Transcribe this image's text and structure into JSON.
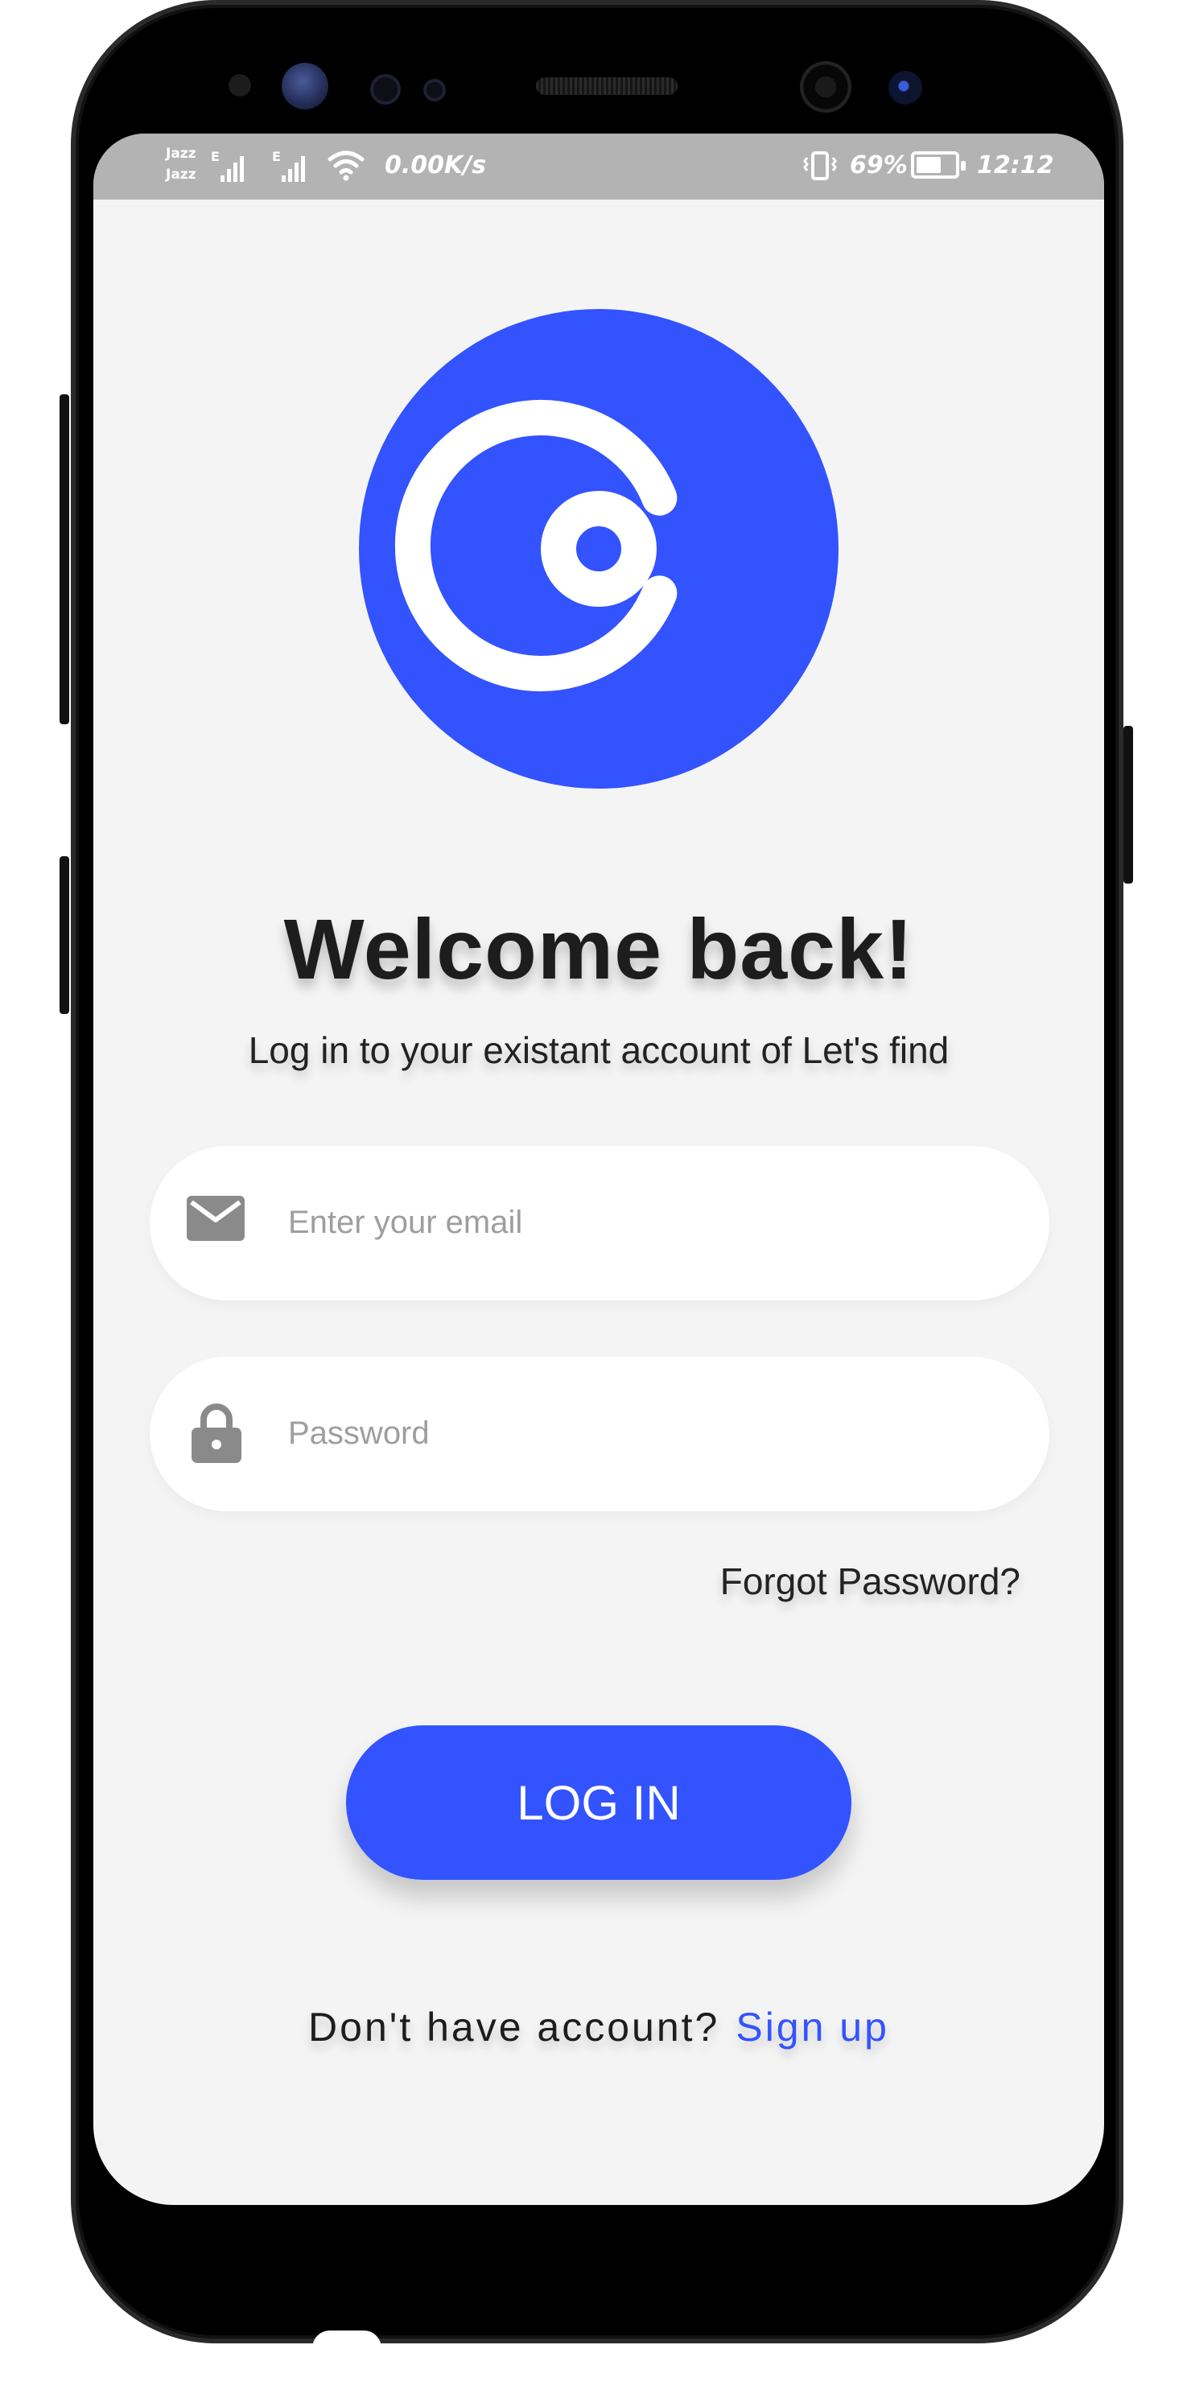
{
  "status_bar": {
    "carrier_1": "Jazz",
    "carrier_2": "Jazz",
    "network_1": "E",
    "network_2": "E",
    "net_speed": "0.00K/s",
    "battery_percent": "69%",
    "battery_level": 0.69,
    "time": "12:12",
    "icons": [
      "signal-icon",
      "signal-icon",
      "wifi-icon",
      "vibrate-icon",
      "battery-icon"
    ]
  },
  "logo": {
    "icon": "app-logo",
    "color": "#3353ff"
  },
  "welcome": {
    "title": "Welcome back!",
    "subtitle": "Log in to your existant account of Let's find"
  },
  "form": {
    "email": {
      "icon": "mail-icon",
      "placeholder": "Enter your email",
      "value": ""
    },
    "password": {
      "icon": "lock-icon",
      "placeholder": "Password",
      "value": ""
    },
    "forgot_password": "Forgot Password?",
    "login_label": "LOG IN"
  },
  "signup": {
    "prompt": "Don't have account?",
    "link": "Sign up"
  },
  "colors": {
    "accent": "#3353ff",
    "background": "#f4f4f4",
    "status_bar": "#b3b3b3"
  }
}
